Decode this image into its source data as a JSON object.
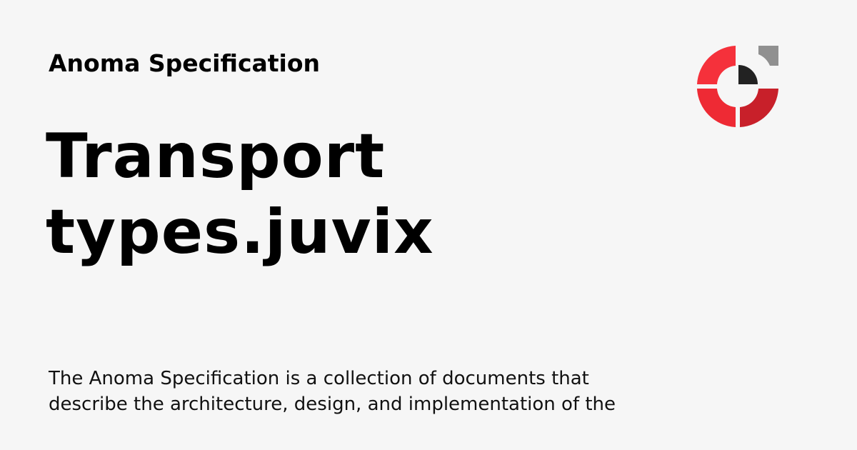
{
  "site": {
    "name": "Anoma Specification"
  },
  "page": {
    "title_line1": "Transport",
    "title_line2": "types.juvix",
    "description_line1": "The Anoma Specification is a collection of documents that",
    "description_line2": "describe the architecture, design, and implementation of the"
  },
  "logo": {
    "icon": "anoma-logo-icon",
    "colors": {
      "red_light": "#f5313b",
      "red_dark": "#c8202a",
      "black": "#222222",
      "gray": "#909090"
    }
  },
  "colors": {
    "background": "#f6f6f6",
    "text": "#000000"
  }
}
